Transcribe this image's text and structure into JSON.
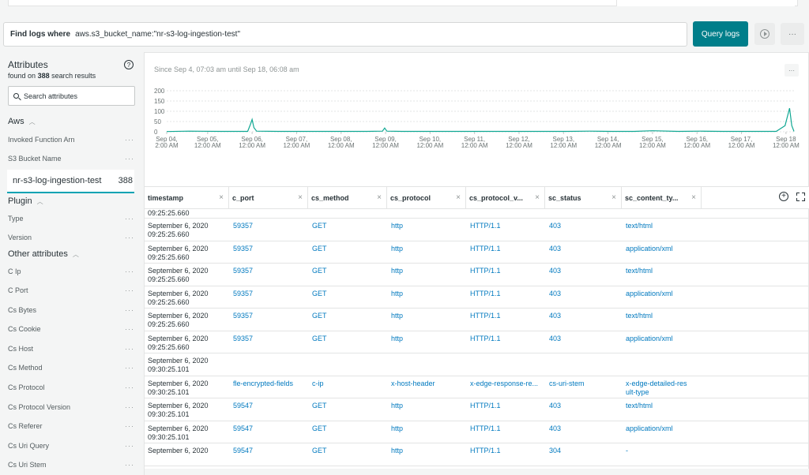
{
  "query": {
    "label": "Find logs where",
    "value": "aws.s3_bucket_name:\"nr-s3-log-ingestion-test\"",
    "button": "Query logs",
    "more": "···"
  },
  "sidebar": {
    "title": "Attributes",
    "found_prefix": "found on",
    "found_count": "388",
    "found_suffix": "search results",
    "search_placeholder": "Search attributes",
    "groups": [
      {
        "label": "Aws",
        "items": [
          "Invoked Function Arn",
          "S3 Bucket Name"
        ]
      },
      {
        "label": "Plugin",
        "items": [
          "Type",
          "Version"
        ]
      },
      {
        "label": "Other attributes",
        "items": [
          "C Ip",
          "C Port",
          "Cs Bytes",
          "Cs Cookie",
          "Cs Host",
          "Cs Method",
          "Cs Protocol",
          "Cs Protocol Version",
          "Cs Referer",
          "Cs Uri Query",
          "Cs Uri Stem"
        ]
      }
    ],
    "selected_value": {
      "label": "nr-s3-log-ingestion-test",
      "count": "388"
    },
    "dots": "···"
  },
  "chart_header": {
    "range": "Since Sep 4, 07:03 am until Sep 18, 06:08 am",
    "more": "···"
  },
  "chart_data": {
    "type": "line",
    "y_ticks": [
      "200",
      "150",
      "100",
      "50",
      "0"
    ],
    "ylim": [
      0,
      200
    ],
    "x_labels": [
      [
        "Sep 04,",
        "2:00 AM"
      ],
      [
        "Sep 05,",
        "12:00 AM"
      ],
      [
        "Sep 06,",
        "12:00 AM"
      ],
      [
        "Sep 07,",
        "12:00 AM"
      ],
      [
        "Sep 08,",
        "12:00 AM"
      ],
      [
        "Sep 09,",
        "12:00 AM"
      ],
      [
        "Sep 10,",
        "12:00 AM"
      ],
      [
        "Sep 11,",
        "12:00 AM"
      ],
      [
        "Sep 12,",
        "12:00 AM"
      ],
      [
        "Sep 13,",
        "12:00 AM"
      ],
      [
        "Sep 14,",
        "12:00 AM"
      ],
      [
        "Sep 15,",
        "12:00 AM"
      ],
      [
        "Sep 16,",
        "12:00 AM"
      ],
      [
        "Sep 17,",
        "12:00 AM"
      ],
      [
        "Sep 18",
        "12:00 AM"
      ]
    ],
    "x_days": [
      0,
      0.92,
      1.92,
      2.92,
      3.92,
      4.92,
      5.92,
      6.92,
      7.92,
      8.92,
      9.92,
      10.92,
      11.92,
      12.92,
      13.92
    ],
    "series": [
      {
        "color": "#11a893",
        "x": [
          0,
          0.5,
          1.2,
          1.5,
          1.82,
          1.88,
          1.92,
          1.96,
          2.02,
          2.5,
          3.0,
          3.5,
          4.0,
          4.5,
          4.85,
          4.9,
          4.95,
          5.3,
          6.0,
          6.5,
          7.0,
          7.5,
          8.0,
          8.5,
          9.0,
          9.5,
          10.0,
          10.5,
          10.92,
          11.5,
          12.0,
          12.5,
          13.0,
          13.7,
          13.9,
          14.0,
          14.05,
          14.1
        ],
        "y": [
          1,
          3,
          2,
          2,
          2,
          35,
          60,
          20,
          3,
          2,
          2,
          2,
          2,
          2,
          3,
          18,
          3,
          2,
          2,
          2,
          2,
          2,
          2,
          2,
          2,
          3,
          2,
          2,
          5,
          2,
          3,
          2,
          2,
          2,
          30,
          115,
          30,
          2
        ]
      }
    ]
  },
  "table": {
    "columns": [
      "timestamp",
      "c_port",
      "cs_method",
      "cs_protocol",
      "cs_protocol_v...",
      "sc_status",
      "sc_content_ty..."
    ],
    "close": "×",
    "partial_top": "09:25:25.660",
    "rows": [
      {
        "ts": [
          "September 6, 2020",
          "09:25:25.660"
        ],
        "c": [
          "59357",
          "GET",
          "http",
          "HTTP/1.1",
          "403",
          "text/html"
        ]
      },
      {
        "ts": [
          "September 6, 2020",
          "09:25:25.660"
        ],
        "c": [
          "59357",
          "GET",
          "http",
          "HTTP/1.1",
          "403",
          "application/xml"
        ]
      },
      {
        "ts": [
          "September 6, 2020",
          "09:25:25.660"
        ],
        "c": [
          "59357",
          "GET",
          "http",
          "HTTP/1.1",
          "403",
          "text/html"
        ]
      },
      {
        "ts": [
          "September 6, 2020",
          "09:25:25.660"
        ],
        "c": [
          "59357",
          "GET",
          "http",
          "HTTP/1.1",
          "403",
          "application/xml"
        ]
      },
      {
        "ts": [
          "September 6, 2020",
          "09:25:25.660"
        ],
        "c": [
          "59357",
          "GET",
          "http",
          "HTTP/1.1",
          "403",
          "text/html"
        ]
      },
      {
        "ts": [
          "September 6, 2020",
          "09:25:25.660"
        ],
        "c": [
          "59357",
          "GET",
          "http",
          "HTTP/1.1",
          "403",
          "application/xml"
        ]
      },
      {
        "ts": [
          "September 6, 2020",
          "09:30:25.101"
        ],
        "c": [
          "",
          "",
          "",
          "",
          "",
          ""
        ]
      },
      {
        "ts": [
          "September 6, 2020",
          "09:30:25.101"
        ],
        "c": [
          "fle-encrypted-fields",
          "c-ip",
          "x-host-header",
          "x-edge-response-re...",
          "cs-uri-stem",
          "x-edge-detailed-res\nult-type"
        ]
      },
      {
        "ts": [
          "September 6, 2020",
          "09:30:25.101"
        ],
        "c": [
          "59547",
          "GET",
          "http",
          "HTTP/1.1",
          "403",
          "text/html"
        ]
      },
      {
        "ts": [
          "September 6, 2020",
          "09:30:25.101"
        ],
        "c": [
          "59547",
          "GET",
          "http",
          "HTTP/1.1",
          "403",
          "application/xml"
        ]
      },
      {
        "ts": [
          "September 6, 2020",
          ""
        ],
        "c": [
          "59547",
          "GET",
          "http",
          "HTTP/1.1",
          "304",
          "-"
        ]
      }
    ]
  }
}
